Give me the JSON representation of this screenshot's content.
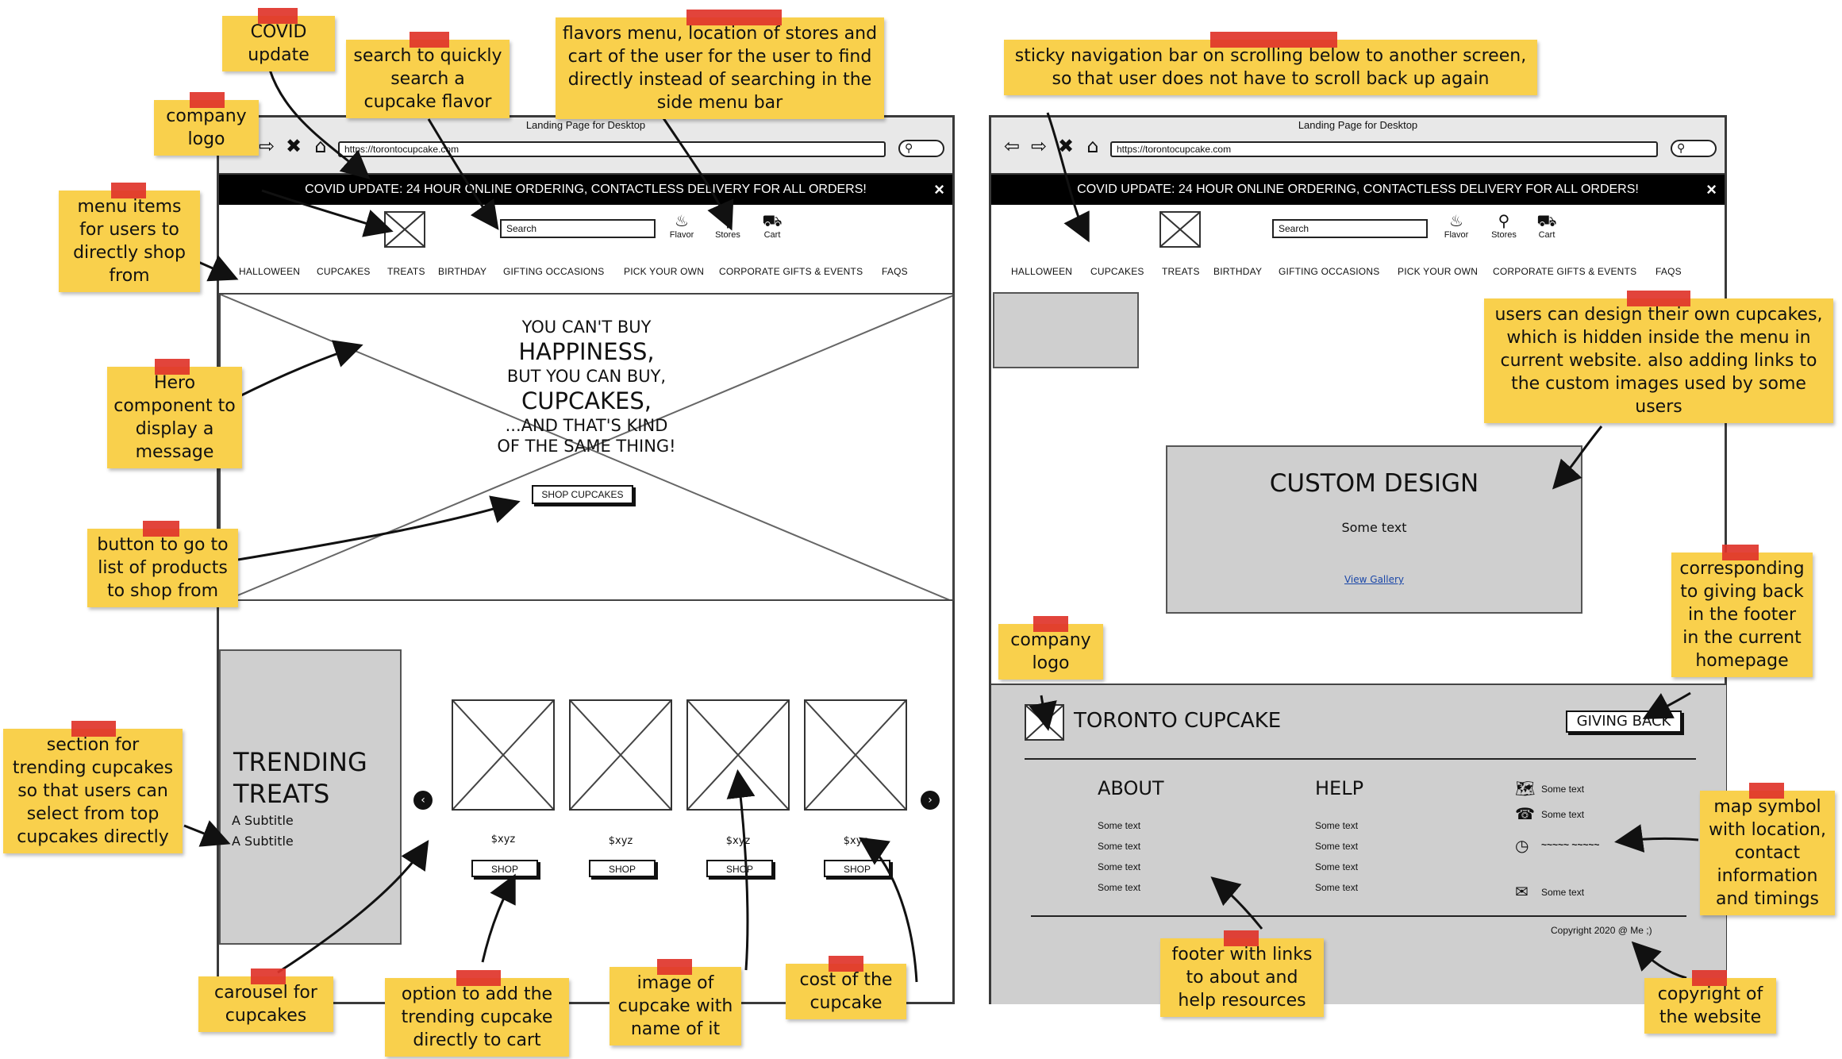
{
  "left": {
    "window_title": "Landing Page for Desktop",
    "url": "https://torontocupcake.com",
    "covid_banner": "COVID UPDATE: 24 HOUR ONLINE ORDERING, CONTACTLESS DELIVERY FOR ALL ORDERS!",
    "close_icon": "×",
    "search_placeholder": "Search",
    "icons": {
      "flavor": "Flavor",
      "stores": "Stores",
      "cart": "Cart"
    },
    "menu": [
      "HALLOWEEN",
      "CUPCAKES",
      "TREATS",
      "BIRTHDAY",
      "GIFTING OCCASIONS",
      "PICK YOUR OWN",
      "CORPORATE GIFTS & EVENTS",
      "FAQS"
    ],
    "hero": {
      "line1": "YOU CAN'T BUY",
      "line2": "HAPPINESS,",
      "line3": "BUT YOU CAN BUY,",
      "line4": "CUPCAKES,",
      "line5": "...AND THAT'S KIND",
      "line6": "OF THE SAME THING!",
      "button": "SHOP CUPCAKES"
    },
    "trending": {
      "title": "TRENDING TREATS",
      "subtitle1": "A Subtitle",
      "subtitle2": "A Subtitle",
      "cards": [
        {
          "price": "$xyz",
          "button": "SHOP"
        },
        {
          "price": "$xyz",
          "button": "SHOP"
        },
        {
          "price": "$xyz",
          "button": "SHOP"
        },
        {
          "price": "$xyz",
          "button": "SHOP"
        }
      ],
      "prev": "‹",
      "next": "›"
    }
  },
  "right": {
    "window_title": "Landing Page for Desktop",
    "url": "https://torontocupcake.com",
    "covid_banner": "COVID UPDATE: 24 HOUR ONLINE ORDERING, CONTACTLESS DELIVERY FOR ALL ORDERS!",
    "close_icon": "×",
    "search_placeholder": "Search",
    "icons": {
      "flavor": "Flavor",
      "stores": "Stores",
      "cart": "Cart"
    },
    "menu": [
      "HALLOWEEN",
      "CUPCAKES",
      "TREATS",
      "BIRTHDAY",
      "GIFTING OCCASIONS",
      "PICK YOUR OWN",
      "CORPORATE GIFTS & EVENTS",
      "FAQS"
    ],
    "custom": {
      "title": "CUSTOM DESIGN",
      "text": "Some text",
      "link": "View Gallery"
    },
    "footer": {
      "brand": "TORONTO CUPCAKE",
      "giving_back": "GIVING BACK",
      "about": {
        "heading": "ABOUT",
        "links": [
          "Some text",
          "Some text",
          "Some text",
          "Some text"
        ]
      },
      "help": {
        "heading": "HELP",
        "links": [
          "Some text",
          "Some text",
          "Some text",
          "Some text"
        ]
      },
      "contact": {
        "map": "Some text",
        "phone": "Some text",
        "hours": "~~~~~ ~~~~~",
        "email": "Some text"
      },
      "copyright": "Copyright 2020 @ Me ;)"
    }
  },
  "notes": {
    "covid": "COVID update",
    "search": "search to quickly search a cupcake flavor",
    "flavors": "flavors menu, location of stores and cart of the user for the user to find directly instead of searching in the side menu bar",
    "logo_left": "company logo",
    "menu_items": "menu items for users to directly shop from",
    "hero": "Hero component to display a message",
    "button": "button to go to list of products to shop from",
    "trending": "section for trending cupcakes so that users can select from top cupcakes directly",
    "carousel": "carousel for cupcakes",
    "add_to_cart": "option to add the trending cupcake directly to cart",
    "image_name": "image of cupcake with name of it",
    "cost": "cost of the cupcake",
    "sticky": "sticky navigation bar on scrolling below to another screen, so that user does not have to scroll back up again",
    "custom": "users can design their own cupcakes, which is hidden inside the menu in current website. also adding links to the custom images used by some users",
    "giving_back": "corresponding to giving back in the footer in the current homepage",
    "logo_right": "company logo",
    "map": "map symbol with location, contact information and timings",
    "footer_links": "footer with links to about and help resources",
    "copyright": "copyright of the website"
  },
  "colors": {
    "note": "#f9d04c",
    "tape": "#e0342a",
    "wire_grey": "#cfcfcf",
    "banner": "#000000"
  }
}
